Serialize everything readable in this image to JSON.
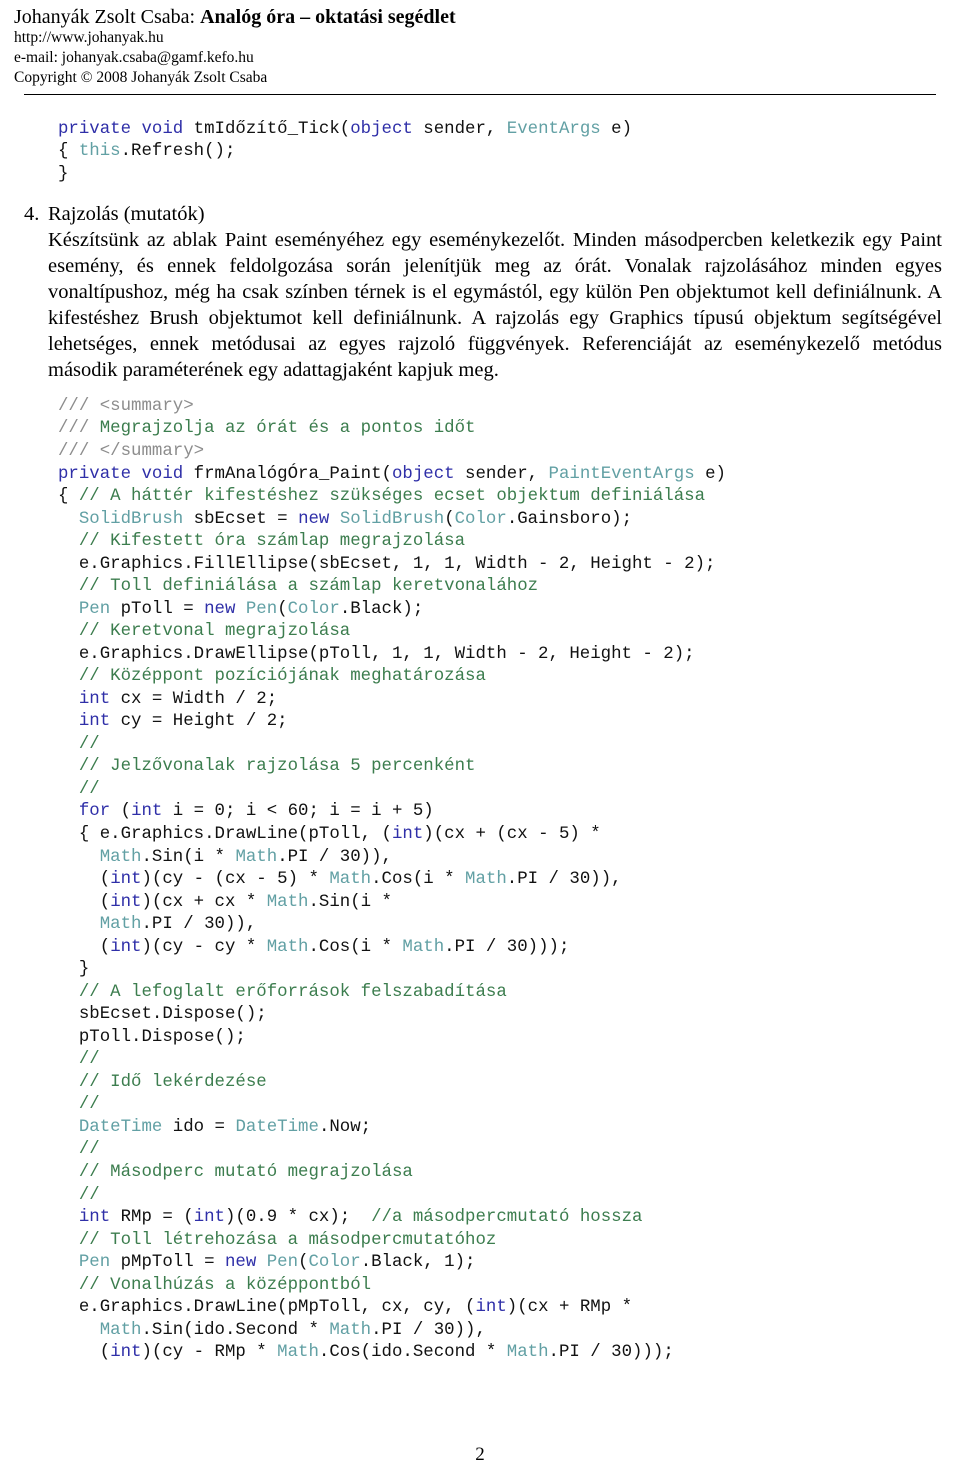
{
  "header": {
    "author": "Johanyák Zsolt Csaba: ",
    "subject": "Analóg óra – oktatási segédlet",
    "website": "http://www.johanyak.hu",
    "email": "e-mail: johanyak.csaba@gamf.kefo.hu",
    "copyright": "Copyright © 2008 Johanyák Zsolt Csaba"
  },
  "section": {
    "number": "4.",
    "heading": "Rajzolás (mutatók)",
    "paragraph": "Készítsünk az ablak Paint eseményéhez egy eseménykezelőt. Minden másodpercben keletkezik egy Paint esemény, és ennek feldolgozása során jelenítjük meg az órát. Vonalak rajzolásához minden egyes vonaltípushoz, még ha csak színben térnek is el egymástól, egy külön Pen objektumot kell definiálnunk. A kifestéshez Brush objektumot kell definiálnunk. A rajzolás egy Graphics típusú objektum segítségével lehetséges, ennek metódusai az egyes rajzoló függvények. Referenciáját az eseménykezelő metódus második paraméterének egy adattagjaként kapjuk meg."
  },
  "code_tick": {
    "language": "csharp",
    "lines": [
      [
        {
          "t": "private void",
          "c": "kw"
        },
        {
          "t": " tmIdőzítő_Tick(",
          "c": "pln"
        },
        {
          "t": "object",
          "c": "kw"
        },
        {
          "t": " sender, ",
          "c": "pln"
        },
        {
          "t": "EventArgs",
          "c": "typ"
        },
        {
          "t": " e)",
          "c": "pln"
        }
      ],
      [
        {
          "t": "{ ",
          "c": "pln"
        },
        {
          "t": "this",
          "c": "typ"
        },
        {
          "t": ".Refresh();",
          "c": "pln"
        }
      ],
      [
        {
          "t": "}",
          "c": "pln"
        }
      ]
    ]
  },
  "code_paint": {
    "language": "csharp",
    "lines": [
      [
        {
          "t": "/// ",
          "c": "cmt-slash"
        },
        {
          "t": "<summary>",
          "c": "cmt-slash"
        }
      ],
      [
        {
          "t": "/// ",
          "c": "cmt-slash"
        },
        {
          "t": "Megrajzolja az órát és a pontos időt",
          "c": "cmt"
        }
      ],
      [
        {
          "t": "/// ",
          "c": "cmt-slash"
        },
        {
          "t": "</summary>",
          "c": "cmt-slash"
        }
      ],
      [
        {
          "t": "private void",
          "c": "kw"
        },
        {
          "t": " frmAnalógÓra_Paint(",
          "c": "pln"
        },
        {
          "t": "object",
          "c": "kw"
        },
        {
          "t": " sender, ",
          "c": "pln"
        },
        {
          "t": "PaintEventArgs",
          "c": "typ"
        },
        {
          "t": " e)",
          "c": "pln"
        }
      ],
      [
        {
          "t": "{ ",
          "c": "pln"
        },
        {
          "t": "// A háttér kifestéshez szükséges ecset objektum definiálása",
          "c": "cmt"
        }
      ],
      [
        {
          "t": "  ",
          "c": "pln"
        },
        {
          "t": "SolidBrush",
          "c": "typ"
        },
        {
          "t": " sbEcset = ",
          "c": "pln"
        },
        {
          "t": "new",
          "c": "kw"
        },
        {
          "t": " ",
          "c": "pln"
        },
        {
          "t": "SolidBrush",
          "c": "typ"
        },
        {
          "t": "(",
          "c": "pln"
        },
        {
          "t": "Color",
          "c": "typ"
        },
        {
          "t": ".Gainsboro);",
          "c": "pln"
        }
      ],
      [
        {
          "t": "  ",
          "c": "pln"
        },
        {
          "t": "// Kifestett óra számlap megrajzolása",
          "c": "cmt"
        }
      ],
      [
        {
          "t": "  e.Graphics.FillEllipse(sbEcset, 1, 1, Width - 2, Height - 2);",
          "c": "pln"
        }
      ],
      [
        {
          "t": "  ",
          "c": "pln"
        },
        {
          "t": "// Toll definiálása a számlap keretvonalához",
          "c": "cmt"
        }
      ],
      [
        {
          "t": "  ",
          "c": "pln"
        },
        {
          "t": "Pen",
          "c": "typ"
        },
        {
          "t": " pToll = ",
          "c": "pln"
        },
        {
          "t": "new",
          "c": "kw"
        },
        {
          "t": " ",
          "c": "pln"
        },
        {
          "t": "Pen",
          "c": "typ"
        },
        {
          "t": "(",
          "c": "pln"
        },
        {
          "t": "Color",
          "c": "typ"
        },
        {
          "t": ".Black);",
          "c": "pln"
        }
      ],
      [
        {
          "t": "  ",
          "c": "pln"
        },
        {
          "t": "// Keretvonal megrajzolása",
          "c": "cmt"
        }
      ],
      [
        {
          "t": "  e.Graphics.DrawEllipse(pToll, 1, 1, Width - 2, Height - 2);",
          "c": "pln"
        }
      ],
      [
        {
          "t": "  ",
          "c": "pln"
        },
        {
          "t": "// Középpont pozíciójának meghatározása",
          "c": "cmt"
        }
      ],
      [
        {
          "t": "  ",
          "c": "pln"
        },
        {
          "t": "int",
          "c": "kw"
        },
        {
          "t": " cx = Width / 2;",
          "c": "pln"
        }
      ],
      [
        {
          "t": "  ",
          "c": "pln"
        },
        {
          "t": "int",
          "c": "kw"
        },
        {
          "t": " cy = Height / 2;",
          "c": "pln"
        }
      ],
      [
        {
          "t": "  ",
          "c": "pln"
        },
        {
          "t": "//",
          "c": "cmt"
        }
      ],
      [
        {
          "t": "  ",
          "c": "pln"
        },
        {
          "t": "// Jelzővonalak rajzolása 5 percenként",
          "c": "cmt"
        }
      ],
      [
        {
          "t": "  ",
          "c": "pln"
        },
        {
          "t": "//",
          "c": "cmt"
        }
      ],
      [
        {
          "t": "  ",
          "c": "pln"
        },
        {
          "t": "for",
          "c": "kw"
        },
        {
          "t": " (",
          "c": "pln"
        },
        {
          "t": "int",
          "c": "kw"
        },
        {
          "t": " i = 0; i < 60; i = i + 5)",
          "c": "pln"
        }
      ],
      [
        {
          "t": "  { e.Graphics.DrawLine(pToll, (",
          "c": "pln"
        },
        {
          "t": "int",
          "c": "kw"
        },
        {
          "t": ")(cx + (cx - 5) *",
          "c": "pln"
        }
      ],
      [
        {
          "t": "    ",
          "c": "pln"
        },
        {
          "t": "Math",
          "c": "typ"
        },
        {
          "t": ".Sin(i * ",
          "c": "pln"
        },
        {
          "t": "Math",
          "c": "typ"
        },
        {
          "t": ".PI / 30)),",
          "c": "pln"
        }
      ],
      [
        {
          "t": "    (",
          "c": "pln"
        },
        {
          "t": "int",
          "c": "kw"
        },
        {
          "t": ")(cy - (cx - 5) * ",
          "c": "pln"
        },
        {
          "t": "Math",
          "c": "typ"
        },
        {
          "t": ".Cos(i * ",
          "c": "pln"
        },
        {
          "t": "Math",
          "c": "typ"
        },
        {
          "t": ".PI / 30)),",
          "c": "pln"
        }
      ],
      [
        {
          "t": "    (",
          "c": "pln"
        },
        {
          "t": "int",
          "c": "kw"
        },
        {
          "t": ")(cx + cx * ",
          "c": "pln"
        },
        {
          "t": "Math",
          "c": "typ"
        },
        {
          "t": ".Sin(i *",
          "c": "pln"
        }
      ],
      [
        {
          "t": "    ",
          "c": "pln"
        },
        {
          "t": "Math",
          "c": "typ"
        },
        {
          "t": ".PI / 30)),",
          "c": "pln"
        }
      ],
      [
        {
          "t": "    (",
          "c": "pln"
        },
        {
          "t": "int",
          "c": "kw"
        },
        {
          "t": ")(cy - cy * ",
          "c": "pln"
        },
        {
          "t": "Math",
          "c": "typ"
        },
        {
          "t": ".Cos(i * ",
          "c": "pln"
        },
        {
          "t": "Math",
          "c": "typ"
        },
        {
          "t": ".PI / 30)));",
          "c": "pln"
        }
      ],
      [
        {
          "t": "  }",
          "c": "pln"
        }
      ],
      [
        {
          "t": "  ",
          "c": "pln"
        },
        {
          "t": "// A lefoglalt erőforrások felszabadítása",
          "c": "cmt"
        }
      ],
      [
        {
          "t": "  sbEcset.Dispose();",
          "c": "pln"
        }
      ],
      [
        {
          "t": "  pToll.Dispose();",
          "c": "pln"
        }
      ],
      [
        {
          "t": "  ",
          "c": "pln"
        },
        {
          "t": "//",
          "c": "cmt"
        }
      ],
      [
        {
          "t": "  ",
          "c": "pln"
        },
        {
          "t": "// Idő lekérdezése",
          "c": "cmt"
        }
      ],
      [
        {
          "t": "  ",
          "c": "pln"
        },
        {
          "t": "//",
          "c": "cmt"
        }
      ],
      [
        {
          "t": "  ",
          "c": "pln"
        },
        {
          "t": "DateTime",
          "c": "typ"
        },
        {
          "t": " ido = ",
          "c": "pln"
        },
        {
          "t": "DateTime",
          "c": "typ"
        },
        {
          "t": ".Now;",
          "c": "pln"
        }
      ],
      [
        {
          "t": "  ",
          "c": "pln"
        },
        {
          "t": "//",
          "c": "cmt"
        }
      ],
      [
        {
          "t": "  ",
          "c": "pln"
        },
        {
          "t": "// Másodperc mutató megrajzolása",
          "c": "cmt"
        }
      ],
      [
        {
          "t": "  ",
          "c": "pln"
        },
        {
          "t": "//",
          "c": "cmt"
        }
      ],
      [
        {
          "t": "  ",
          "c": "pln"
        },
        {
          "t": "int",
          "c": "kw"
        },
        {
          "t": " RMp = (",
          "c": "pln"
        },
        {
          "t": "int",
          "c": "kw"
        },
        {
          "t": ")(0.9 * cx);  ",
          "c": "pln"
        },
        {
          "t": "//a másodpercmutató hossza",
          "c": "cmt"
        }
      ],
      [
        {
          "t": "  ",
          "c": "pln"
        },
        {
          "t": "// Toll létrehozása a másodpercmutatóhoz",
          "c": "cmt"
        }
      ],
      [
        {
          "t": "  ",
          "c": "pln"
        },
        {
          "t": "Pen",
          "c": "typ"
        },
        {
          "t": " pMpToll = ",
          "c": "pln"
        },
        {
          "t": "new",
          "c": "kw"
        },
        {
          "t": " ",
          "c": "pln"
        },
        {
          "t": "Pen",
          "c": "typ"
        },
        {
          "t": "(",
          "c": "pln"
        },
        {
          "t": "Color",
          "c": "typ"
        },
        {
          "t": ".Black, 1);",
          "c": "pln"
        }
      ],
      [
        {
          "t": "  ",
          "c": "pln"
        },
        {
          "t": "// Vonalhúzás a középpontból",
          "c": "cmt"
        }
      ],
      [
        {
          "t": "  e.Graphics.DrawLine(pMpToll, cx, cy, (",
          "c": "pln"
        },
        {
          "t": "int",
          "c": "kw"
        },
        {
          "t": ")(cx + RMp *",
          "c": "pln"
        }
      ],
      [
        {
          "t": "    ",
          "c": "pln"
        },
        {
          "t": "Math",
          "c": "typ"
        },
        {
          "t": ".Sin(ido.Second * ",
          "c": "pln"
        },
        {
          "t": "Math",
          "c": "typ"
        },
        {
          "t": ".PI / 30)),",
          "c": "pln"
        }
      ],
      [
        {
          "t": "    (",
          "c": "pln"
        },
        {
          "t": "int",
          "c": "kw"
        },
        {
          "t": ")(cy - RMp * ",
          "c": "pln"
        },
        {
          "t": "Math",
          "c": "typ"
        },
        {
          "t": ".Cos(ido.Second * ",
          "c": "pln"
        },
        {
          "t": "Math",
          "c": "typ"
        },
        {
          "t": ".PI / 30)));",
          "c": "pln"
        }
      ]
    ]
  },
  "footer": {
    "page_number": "2"
  },
  "colors": {
    "keyword": "#2f2fa8",
    "type": "#62a0a4",
    "comment": "#3c7d4e",
    "comment_slash": "#8d8d8d",
    "plain": "#111111",
    "text": "#000000",
    "background": "#ffffff"
  }
}
